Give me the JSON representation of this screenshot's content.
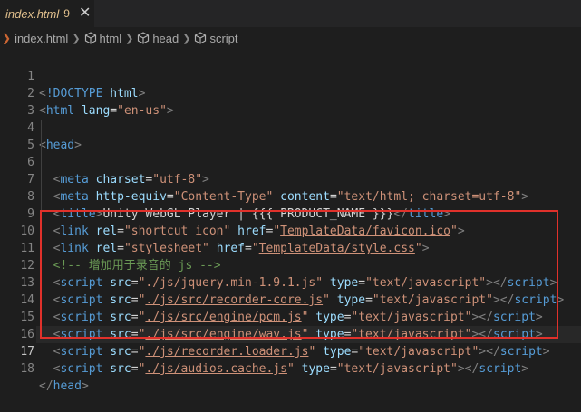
{
  "tab": {
    "title": "index.html",
    "problem_count": "9",
    "close_glyph": "✕"
  },
  "breadcrumb": {
    "items": [
      "index.html",
      "html",
      "head",
      "script"
    ]
  },
  "editor": {
    "active_line": 17,
    "lines": [
      {
        "n": "1"
      },
      {
        "n": "2"
      },
      {
        "n": "3"
      },
      {
        "n": "4"
      },
      {
        "n": "5"
      },
      {
        "n": "6"
      },
      {
        "n": "7"
      },
      {
        "n": "8"
      },
      {
        "n": "9"
      },
      {
        "n": "10"
      },
      {
        "n": "11"
      },
      {
        "n": "12"
      },
      {
        "n": "13"
      },
      {
        "n": "14"
      },
      {
        "n": "15"
      },
      {
        "n": "16"
      },
      {
        "n": "17"
      },
      {
        "n": "18"
      }
    ],
    "doctype": "<!DOCTYPE html>",
    "html_lang": "en-us",
    "meta_charset": "utf-8",
    "meta_equiv": "Content-Type",
    "meta_content": "text/html; charset=utf-8",
    "title_text": "Unity WebGL Player | {{{ PRODUCT_NAME }}}",
    "link1_rel": "shortcut icon",
    "link1_href": "TemplateData/favicon.ico",
    "link2_rel": "stylesheet",
    "link2_href": "TemplateData/style.css",
    "comment": "<!-- 增加用于录音的 js -->",
    "scripts": [
      {
        "src": "./js/jquery.min-1.9.1.js"
      },
      {
        "src": "./js/src/recorder-core.js"
      },
      {
        "src": "./js/src/engine/pcm.js"
      },
      {
        "src": "./js/src/engine/wav.js"
      },
      {
        "src": "./js/recorder.loader.js"
      },
      {
        "src": "./js/audios.cache.js"
      }
    ],
    "script_type": "text/javascript"
  },
  "colors": {
    "highlight_border": "#e0312b",
    "tab_modified": "#e2c08d"
  }
}
